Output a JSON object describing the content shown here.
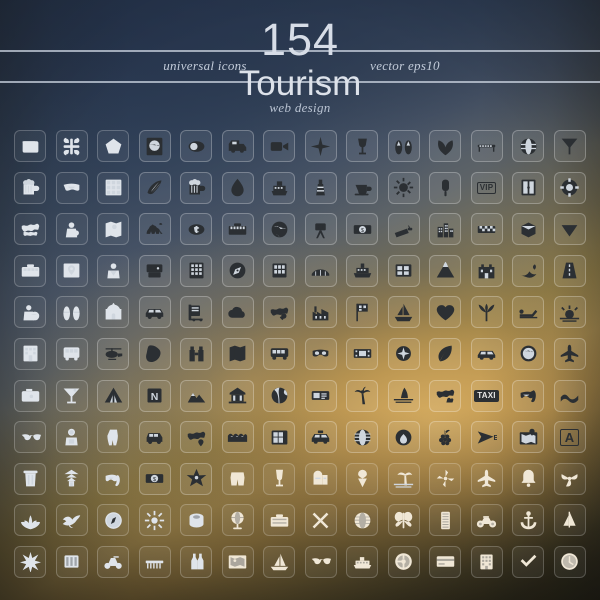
{
  "poster": {
    "header": {
      "count": "154",
      "title": "Tourism",
      "left_label": "universal icons",
      "right_label": "vector eps10",
      "sub_label": "web design"
    },
    "colors": {
      "bg_top_left": "#2b3b53",
      "bg_mid_warm": "#c2a15a",
      "bg_bottom": "#2b2a1c",
      "rule": "#d0d8e4",
      "heading_text": "#dde2ea",
      "serif_text": "#c3ccda",
      "icon_dark": "#2b2f33",
      "icon_light": "#dfe4ea",
      "tile_border": "rgba(255,255,255,0.20)"
    },
    "grid": {
      "columns": 14,
      "rows": 11,
      "total": 154,
      "tile_size": 32,
      "tile_radius": 6
    },
    "icons": [
      {
        "name": "wallet-icon",
        "glyph": "wallet",
        "ink": "light"
      },
      {
        "name": "luggage-tag-icon",
        "glyph": "bags",
        "ink": "light"
      },
      {
        "name": "pentagon-sign-icon",
        "glyph": "pentagon",
        "ink": "light"
      },
      {
        "name": "globe-card-icon",
        "glyph": "globecard",
        "ink": "dark"
      },
      {
        "name": "eclipse-icon",
        "glyph": "eclipse",
        "ink": "dark"
      },
      {
        "name": "camper-van-icon",
        "glyph": "van",
        "ink": "dark"
      },
      {
        "name": "video-camera-icon",
        "glyph": "videocam",
        "ink": "dark"
      },
      {
        "name": "compass-rose-icon",
        "glyph": "compassrose",
        "ink": "dark"
      },
      {
        "name": "wine-glass-icon",
        "glyph": "wineglass",
        "ink": "dark"
      },
      {
        "name": "flip-flops-icon",
        "glyph": "flipflops",
        "ink": "dark"
      },
      {
        "name": "leaf-pair-icon",
        "glyph": "leafpair",
        "ink": "dark"
      },
      {
        "name": "bench-icon",
        "glyph": "bench",
        "ink": "dark"
      },
      {
        "name": "globe-grid-icon",
        "glyph": "globegrid",
        "ink": "dark"
      },
      {
        "name": "pennant-icon",
        "glyph": "pennant",
        "ink": "dark"
      },
      {
        "name": "beer-mug-icon",
        "glyph": "beer",
        "ink": "light"
      },
      {
        "name": "ski-goggles-icon",
        "glyph": "goggles",
        "ink": "light"
      },
      {
        "name": "city-map-icon",
        "glyph": "citymap",
        "ink": "light"
      },
      {
        "name": "seashell-icon",
        "glyph": "shell",
        "ink": "dark"
      },
      {
        "name": "beer-mug-2-icon",
        "glyph": "beer",
        "ink": "dark"
      },
      {
        "name": "flame-leaf-icon",
        "glyph": "flameleaf",
        "ink": "dark"
      },
      {
        "name": "cruise-ship-icon",
        "glyph": "ship",
        "ink": "dark"
      },
      {
        "name": "lighthouse-icon",
        "glyph": "lighthouse",
        "ink": "dark"
      },
      {
        "name": "coffee-cup-icon",
        "glyph": "coffee",
        "ink": "dark"
      },
      {
        "name": "sun-icon",
        "glyph": "sun",
        "ink": "dark"
      },
      {
        "name": "ice-cream-bar-icon",
        "glyph": "icecreambar",
        "ink": "dark"
      },
      {
        "name": "vip-badge-icon",
        "glyph": "vip",
        "ink": "dark",
        "label": "VIP"
      },
      {
        "name": "hotel-door-icon",
        "glyph": "hoteldoor",
        "ink": "dark"
      },
      {
        "name": "life-ring-icon",
        "glyph": "lifering",
        "ink": "dark"
      },
      {
        "name": "world-map-icon",
        "glyph": "worldmap",
        "ink": "light"
      },
      {
        "name": "hunter-icon",
        "glyph": "hunter",
        "ink": "light"
      },
      {
        "name": "folded-map-icon",
        "glyph": "foldmap",
        "ink": "light"
      },
      {
        "name": "camel-icon",
        "glyph": "camel",
        "ink": "dark"
      },
      {
        "name": "coins-icon",
        "glyph": "coins",
        "ink": "dark"
      },
      {
        "name": "suitcase-icon",
        "glyph": "suitcase",
        "ink": "dark"
      },
      {
        "name": "earth-globe-icon",
        "glyph": "earth",
        "ink": "dark"
      },
      {
        "name": "tripod-camera-icon",
        "glyph": "tripod",
        "ink": "dark"
      },
      {
        "name": "banknote-icon",
        "glyph": "banknote",
        "ink": "dark"
      },
      {
        "name": "cigarette-icon",
        "glyph": "cigarette",
        "ink": "dark"
      },
      {
        "name": "city-skyline-icon",
        "glyph": "skyline",
        "ink": "dark"
      },
      {
        "name": "taxi-check-icon",
        "glyph": "taxicheck",
        "ink": "dark"
      },
      {
        "name": "crate-stack-icon",
        "glyph": "crates",
        "ink": "dark"
      },
      {
        "name": "bikini-bottom-icon",
        "glyph": "bikini",
        "ink": "dark"
      },
      {
        "name": "toolbox-icon",
        "glyph": "toolbox",
        "ink": "light"
      },
      {
        "name": "map-pin-icon",
        "glyph": "mappin",
        "ink": "light"
      },
      {
        "name": "tourist-icon",
        "glyph": "tourist",
        "ink": "light"
      },
      {
        "name": "instant-camera-icon",
        "glyph": "instacam",
        "ink": "dark"
      },
      {
        "name": "apartment-icon",
        "glyph": "apartment",
        "ink": "dark"
      },
      {
        "name": "compass-icon",
        "glyph": "compass",
        "ink": "dark"
      },
      {
        "name": "hotel-window-icon",
        "glyph": "hotelwin",
        "ink": "dark"
      },
      {
        "name": "bridge-icon",
        "glyph": "bridge",
        "ink": "dark"
      },
      {
        "name": "ferry-icon",
        "glyph": "ferry",
        "ink": "dark"
      },
      {
        "name": "window-icon",
        "glyph": "window",
        "ink": "dark"
      },
      {
        "name": "volcano-icon",
        "glyph": "volcano",
        "ink": "dark"
      },
      {
        "name": "castle-icon",
        "glyph": "castle",
        "ink": "dark"
      },
      {
        "name": "whale-tail-icon",
        "glyph": "whale",
        "ink": "dark"
      },
      {
        "name": "road-icon",
        "glyph": "road",
        "ink": "dark"
      },
      {
        "name": "traveler-globe-icon",
        "glyph": "travglobe",
        "ink": "light"
      },
      {
        "name": "slippers-icon",
        "glyph": "slippers",
        "ink": "light"
      },
      {
        "name": "mosque-icon",
        "glyph": "mosque",
        "ink": "light"
      },
      {
        "name": "car-icon",
        "glyph": "car",
        "ink": "dark"
      },
      {
        "name": "luggage-cart-icon",
        "glyph": "cart",
        "ink": "dark"
      },
      {
        "name": "cloud-icon",
        "glyph": "cloud",
        "ink": "dark"
      },
      {
        "name": "world-route-icon",
        "glyph": "worldroute",
        "ink": "dark"
      },
      {
        "name": "factory-icon",
        "glyph": "factory",
        "ink": "dark"
      },
      {
        "name": "flag-marker-icon",
        "glyph": "flagmark",
        "ink": "dark"
      },
      {
        "name": "sailboat-2-icon",
        "glyph": "sailboat",
        "ink": "dark"
      },
      {
        "name": "heart-icon",
        "glyph": "heart",
        "ink": "dark"
      },
      {
        "name": "palm-fan-icon",
        "glyph": "palmfan",
        "ink": "dark"
      },
      {
        "name": "sun-lounger-icon",
        "glyph": "lounger",
        "ink": "dark"
      },
      {
        "name": "sunrise-icon",
        "glyph": "sunrise",
        "ink": "dark"
      },
      {
        "name": "hotel-building-icon",
        "glyph": "hotelbldg",
        "ink": "light"
      },
      {
        "name": "bus-icon",
        "glyph": "bus",
        "ink": "light"
      },
      {
        "name": "helicopter-icon",
        "glyph": "helicopter",
        "ink": "dark"
      },
      {
        "name": "brazil-map-icon",
        "glyph": "brazil",
        "ink": "dark"
      },
      {
        "name": "binoculars-icon",
        "glyph": "binoculars",
        "ink": "dark"
      },
      {
        "name": "road-map-icon",
        "glyph": "roadmap",
        "ink": "dark"
      },
      {
        "name": "tour-bus-icon",
        "glyph": "tourbus",
        "ink": "dark"
      },
      {
        "name": "ski-mask-icon",
        "glyph": "skimask",
        "ink": "dark"
      },
      {
        "name": "film-strip-icon",
        "glyph": "filmstrip",
        "ink": "dark"
      },
      {
        "name": "compass-star-icon",
        "glyph": "compassstar",
        "ink": "dark"
      },
      {
        "name": "leaf-icon",
        "glyph": "leaf",
        "ink": "dark"
      },
      {
        "name": "sedan-icon",
        "glyph": "sedan",
        "ink": "dark"
      },
      {
        "name": "globe-circle-icon",
        "glyph": "globecircle",
        "ink": "dark"
      },
      {
        "name": "airplane-icon",
        "glyph": "airplane",
        "ink": "dark"
      },
      {
        "name": "photo-camera-icon",
        "glyph": "photocam",
        "ink": "light"
      },
      {
        "name": "cocktail-glass-icon",
        "glyph": "cocktail",
        "ink": "light"
      },
      {
        "name": "tent-icon",
        "glyph": "tent",
        "ink": "dark"
      },
      {
        "name": "north-sign-icon",
        "glyph": "northsign",
        "ink": "dark"
      },
      {
        "name": "mountains-icon",
        "glyph": "mountains",
        "ink": "dark"
      },
      {
        "name": "temple-icon",
        "glyph": "temple",
        "ink": "dark"
      },
      {
        "name": "beach-ball-icon",
        "glyph": "beachball",
        "ink": "dark"
      },
      {
        "name": "ticket-icon",
        "glyph": "ticket",
        "ink": "dark"
      },
      {
        "name": "palm-tree-icon",
        "glyph": "palmtree",
        "ink": "dark"
      },
      {
        "name": "shark-fin-icon",
        "glyph": "sharkfin",
        "ink": "dark"
      },
      {
        "name": "safari-map-icon",
        "glyph": "safari",
        "ink": "dark"
      },
      {
        "name": "taxi-sign-icon",
        "glyph": "taxi",
        "ink": "dark",
        "label": "TAXI"
      },
      {
        "name": "snorkel-icon",
        "glyph": "snorkel",
        "ink": "dark"
      },
      {
        "name": "wave-icon",
        "glyph": "wave",
        "ink": "dark"
      },
      {
        "name": "sunglasses-icon",
        "glyph": "sunglasses",
        "ink": "light"
      },
      {
        "name": "diver-icon",
        "glyph": "diver",
        "ink": "light"
      },
      {
        "name": "swimsuit-icon",
        "glyph": "swimsuit",
        "ink": "light"
      },
      {
        "name": "suv-icon",
        "glyph": "suv",
        "ink": "dark"
      },
      {
        "name": "world-pin-icon",
        "glyph": "worldpin",
        "ink": "dark"
      },
      {
        "name": "waves-icon",
        "glyph": "waves",
        "ink": "dark"
      },
      {
        "name": "minibar-icon",
        "glyph": "minibar",
        "ink": "dark"
      },
      {
        "name": "taxi-car-icon",
        "glyph": "taxicar",
        "ink": "dark"
      },
      {
        "name": "globe-wire-icon",
        "glyph": "globewire",
        "ink": "dark"
      },
      {
        "name": "fire-moon-icon",
        "glyph": "firemoon",
        "ink": "dark"
      },
      {
        "name": "grapes-icon",
        "glyph": "grapes",
        "ink": "dark"
      },
      {
        "name": "paper-plane-icon",
        "glyph": "paperplane",
        "ink": "dark"
      },
      {
        "name": "location-map-icon",
        "glyph": "locmap",
        "ink": "dark"
      },
      {
        "name": "a-sign-icon",
        "glyph": "asign",
        "ink": "dark",
        "label": "A"
      },
      {
        "name": "trash-bin-icon",
        "glyph": "trashbin",
        "ink": "light"
      },
      {
        "name": "pagoda-icon",
        "glyph": "pagoda",
        "ink": "light"
      },
      {
        "name": "diving-mask-icon",
        "glyph": "divemask",
        "ink": "light"
      },
      {
        "name": "dollar-note-icon",
        "glyph": "dollarnote",
        "ink": "dark"
      },
      {
        "name": "starfish-icon",
        "glyph": "starfish",
        "ink": "dark"
      },
      {
        "name": "swim-trunks-icon",
        "glyph": "trunks",
        "ink": "warm"
      },
      {
        "name": "champagne-glass-icon",
        "glyph": "champagne",
        "ink": "warm"
      },
      {
        "name": "mailbox-icon",
        "glyph": "mailbox",
        "ink": "warm"
      },
      {
        "name": "ice-cream-cone-icon",
        "glyph": "icecream",
        "ink": "warm"
      },
      {
        "name": "palm-beach-icon",
        "glyph": "palmbeach",
        "ink": "warm"
      },
      {
        "name": "windmill-icon",
        "glyph": "windmill",
        "ink": "warm"
      },
      {
        "name": "plane-2-icon",
        "glyph": "plane2",
        "ink": "warm"
      },
      {
        "name": "bell-icon",
        "glyph": "bell",
        "ink": "warm"
      },
      {
        "name": "fan-icon",
        "glyph": "fan",
        "ink": "warm"
      },
      {
        "name": "lotus-icon",
        "glyph": "lotus",
        "ink": "light"
      },
      {
        "name": "dolphin-icon",
        "glyph": "dolphin",
        "ink": "light"
      },
      {
        "name": "compass-dial-icon",
        "glyph": "compassdial",
        "ink": "light"
      },
      {
        "name": "sun-burst-icon",
        "glyph": "sunburst",
        "ink": "light"
      },
      {
        "name": "sushi-icon",
        "glyph": "sushi",
        "ink": "light"
      },
      {
        "name": "globe-stand-icon",
        "glyph": "globestand",
        "ink": "warm"
      },
      {
        "name": "suitcase-2-icon",
        "glyph": "suitcase2",
        "ink": "warm"
      },
      {
        "name": "cross-icon",
        "glyph": "cross",
        "ink": "warm"
      },
      {
        "name": "net-icon",
        "glyph": "net",
        "ink": "warm"
      },
      {
        "name": "butterfly-icon",
        "glyph": "butterfly",
        "ink": "warm"
      },
      {
        "name": "ticket-strip-icon",
        "glyph": "ticketstrip",
        "ink": "warm"
      },
      {
        "name": "motorcycle-icon",
        "glyph": "motorcycle",
        "ink": "warm"
      },
      {
        "name": "anchor-icon",
        "glyph": "anchor",
        "ink": "warm"
      },
      {
        "name": "sailboat-3-icon",
        "glyph": "sail3",
        "ink": "warm"
      },
      {
        "name": "snowflake-star-icon",
        "glyph": "snowstar",
        "ink": "light"
      },
      {
        "name": "dominoes-icon",
        "glyph": "dominoes",
        "ink": "light"
      },
      {
        "name": "scooter-icon",
        "glyph": "scooter",
        "ink": "light"
      },
      {
        "name": "pier-icon",
        "glyph": "pier",
        "ink": "light"
      },
      {
        "name": "bottles-icon",
        "glyph": "bottles",
        "ink": "light"
      },
      {
        "name": "map-frame-icon",
        "glyph": "mapframe",
        "ink": "warm"
      },
      {
        "name": "sailboat-4-icon",
        "glyph": "sail4",
        "ink": "warm"
      },
      {
        "name": "sunglasses-2-icon",
        "glyph": "sunglasses2",
        "ink": "warm"
      },
      {
        "name": "ferry-boat-icon",
        "glyph": "ferryboat",
        "ink": "warm"
      },
      {
        "name": "steering-wheel-icon",
        "glyph": "steering",
        "ink": "warm"
      },
      {
        "name": "credit-card-icon",
        "glyph": "creditcard",
        "ink": "warm"
      },
      {
        "name": "hotel-grid-icon",
        "glyph": "hotelgrid",
        "ink": "warm"
      },
      {
        "name": "check-mark-icon",
        "glyph": "check",
        "ink": "warm"
      },
      {
        "name": "clock-icon",
        "glyph": "clock",
        "ink": "warm"
      }
    ]
  }
}
